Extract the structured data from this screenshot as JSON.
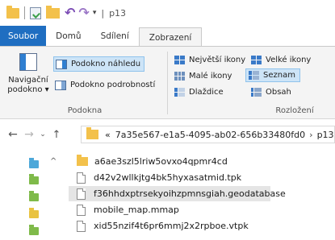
{
  "window": {
    "title": "p13",
    "title_separator": "|"
  },
  "ribbon_tabs": [
    {
      "label": "Soubor"
    },
    {
      "label": "Domů"
    },
    {
      "label": "Sdílení"
    },
    {
      "label": "Zobrazení"
    }
  ],
  "panes_group": {
    "navigation_pane_label_line1": "Navigační",
    "navigation_pane_label_line2": "podokno ▾",
    "preview_pane": "Podokno náhledu",
    "details_pane": "Podokno podrobností",
    "group_label": "Podokna"
  },
  "layout_group": {
    "items": [
      {
        "label": "Největší ikony"
      },
      {
        "label": "Velké ikony"
      },
      {
        "label": "Malé ikony"
      },
      {
        "label": "Seznam"
      },
      {
        "label": "Dlaždice"
      },
      {
        "label": "Obsah"
      }
    ],
    "group_label": "Rozložení",
    "selected": "Seznam"
  },
  "address": {
    "overflow": "«",
    "path_parts": [
      "7a35e567-e1a5-4095-ab02-656b33480fd0",
      "p13"
    ],
    "separator": "›"
  },
  "files": [
    {
      "name": "a6ae3szl5lriw5ovxo4qpmr4cd",
      "type": "folder"
    },
    {
      "name": "d42v2wllkjtg4bk5hyxasatmid.tpk",
      "type": "file"
    },
    {
      "name": "f36hhdxptrsekyoihzpmnsgiah.geodatabase",
      "type": "file",
      "selected": true
    },
    {
      "name": "mobile_map.mmap",
      "type": "file"
    },
    {
      "name": "xid55nzif4t6pr6mmj2x2rpboe.vtpk",
      "type": "file"
    }
  ],
  "colors": {
    "file_tab": "#1f6ec1",
    "folder": "#f3c14b",
    "selection": "#cde4f7"
  }
}
